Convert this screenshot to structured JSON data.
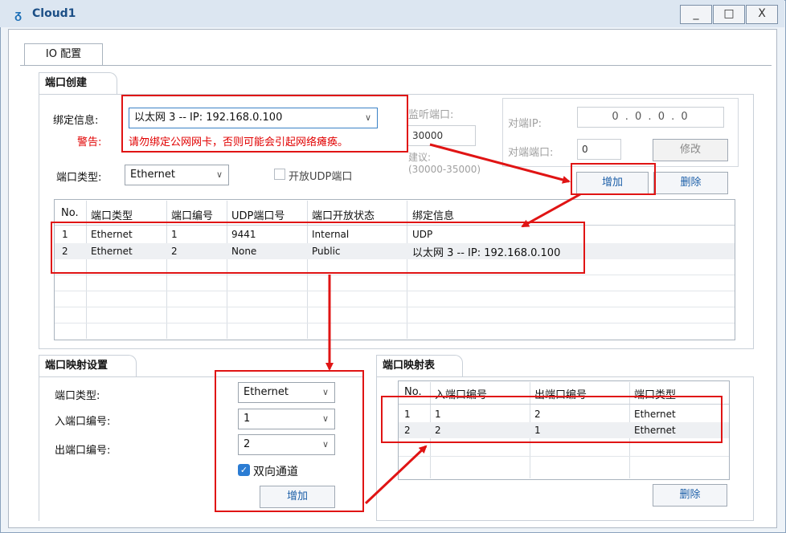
{
  "window": {
    "title": "Cloud1",
    "min": "_",
    "max": "□",
    "close": "X"
  },
  "tabs": {
    "io_config": "IO 配置"
  },
  "port_create": {
    "group_title": "端口创建",
    "bind_label": "绑定信息:",
    "bind_value": "以太网 3 -- IP: 192.168.0.100",
    "warning_label": "警告:",
    "warning_text": "请勿绑定公网网卡，否则可能会引起网络瘫痪。",
    "port_type_label": "端口类型:",
    "port_type_value": "Ethernet",
    "udp_open_label": "开放UDP端口",
    "listen_port_label": "监听端口:",
    "listen_port_value": "30000",
    "suggest_label": "建议:",
    "suggest_range": "(30000-35000)",
    "peer_ip_label": "对端IP:",
    "peer_ip_value": "0 . 0 . 0 . 0",
    "peer_port_label": "对端端口:",
    "peer_port_value": "0",
    "modify_button": "修改",
    "add_button": "增加",
    "delete_button": "删除"
  },
  "port_table": {
    "headers": [
      "No.",
      "端口类型",
      "端口编号",
      "UDP端口号",
      "端口开放状态",
      "绑定信息"
    ],
    "rows": [
      [
        "1",
        "Ethernet",
        "1",
        "9441",
        "Internal",
        "UDP"
      ],
      [
        "2",
        "Ethernet",
        "2",
        "None",
        "Public",
        "以太网 3 -- IP: 192.168.0.100"
      ]
    ]
  },
  "mapping_settings": {
    "group_title": "端口映射设置",
    "port_type_label": "端口类型:",
    "port_type_value": "Ethernet",
    "in_port_label": "入端口编号:",
    "in_port_value": "1",
    "out_port_label": "出端口编号:",
    "out_port_value": "2",
    "bidirectional_label": "双向通道",
    "add_button": "增加"
  },
  "mapping_table": {
    "group_title": "端口映射表",
    "headers": [
      "No.",
      "入端口编号",
      "出端口编号",
      "端口类型"
    ],
    "rows": [
      [
        "1",
        "1",
        "2",
        "Ethernet"
      ],
      [
        "2",
        "2",
        "1",
        "Ethernet"
      ]
    ],
    "delete_button": "删除"
  },
  "colors": {
    "annotation_red": "#e01414",
    "accent_blue": "#1c6fb7"
  }
}
